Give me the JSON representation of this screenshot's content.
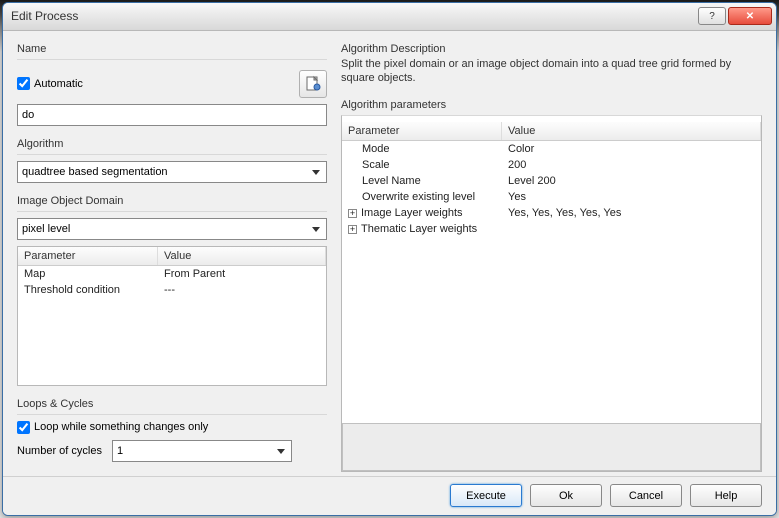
{
  "window": {
    "title": "Edit Process"
  },
  "name_section": {
    "label": "Name",
    "automatic_label": "Automatic",
    "automatic_checked": true,
    "value": "do"
  },
  "algorithm_section": {
    "label": "Algorithm",
    "value": "quadtree based segmentation"
  },
  "domain_section": {
    "label": "Image Object Domain",
    "value": "pixel level",
    "table_headers": {
      "param": "Parameter",
      "value": "Value"
    },
    "rows": [
      {
        "param": "Map",
        "value": "From Parent"
      },
      {
        "param": "Threshold condition",
        "value": "---"
      }
    ]
  },
  "loops_section": {
    "label": "Loops & Cycles",
    "loop_label": "Loop while something changes only",
    "loop_checked": true,
    "cycles_label": "Number of cycles",
    "cycles_value": "1"
  },
  "description_section": {
    "label": "Algorithm Description",
    "text": "Split the pixel domain or an image object domain into a quad tree grid formed by square objects."
  },
  "params_section": {
    "label": "Algorithm parameters",
    "table_headers": {
      "param": "Parameter",
      "value": "Value"
    },
    "rows": [
      {
        "param": "Mode",
        "value": "Color",
        "expand": false
      },
      {
        "param": "Scale",
        "value": "200",
        "expand": false
      },
      {
        "param": "Level Name",
        "value": "Level 200",
        "expand": false
      },
      {
        "param": "Overwrite existing level",
        "value": "Yes",
        "expand": false
      },
      {
        "param": "Image Layer weights",
        "value": "Yes, Yes, Yes, Yes, Yes",
        "expand": true
      },
      {
        "param": "Thematic Layer weights",
        "value": "",
        "expand": true
      }
    ]
  },
  "footer": {
    "execute": "Execute",
    "ok": "Ok",
    "cancel": "Cancel",
    "help": "Help"
  }
}
